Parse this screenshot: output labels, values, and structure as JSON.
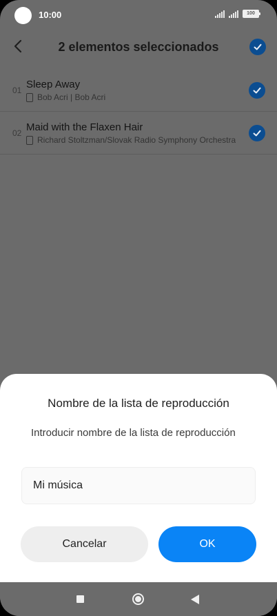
{
  "status_bar": {
    "time": "10:00",
    "battery": "100"
  },
  "header": {
    "title": "2 elementos seleccionados"
  },
  "songs": [
    {
      "number": "01",
      "title": "Sleep Away",
      "subtitle": "Bob Acri | Bob Acri"
    },
    {
      "number": "02",
      "title": "Maid with the Flaxen Hair",
      "subtitle": "Richard Stoltzman/Slovak Radio Symphony Orchestra"
    }
  ],
  "dialog": {
    "title": "Nombre de la lista de reproducción",
    "hint": "Introducir nombre de la lista de reproducción",
    "input_value": "Mi música",
    "cancel_label": "Cancelar",
    "ok_label": "OK"
  },
  "colors": {
    "accent": "#0a84f6",
    "check": "#0b4d91",
    "overlay": "#6b6b6b"
  },
  "icons": {
    "back": "back-arrow-icon",
    "check": "check-circle-icon",
    "song": "phone-storage-icon"
  }
}
